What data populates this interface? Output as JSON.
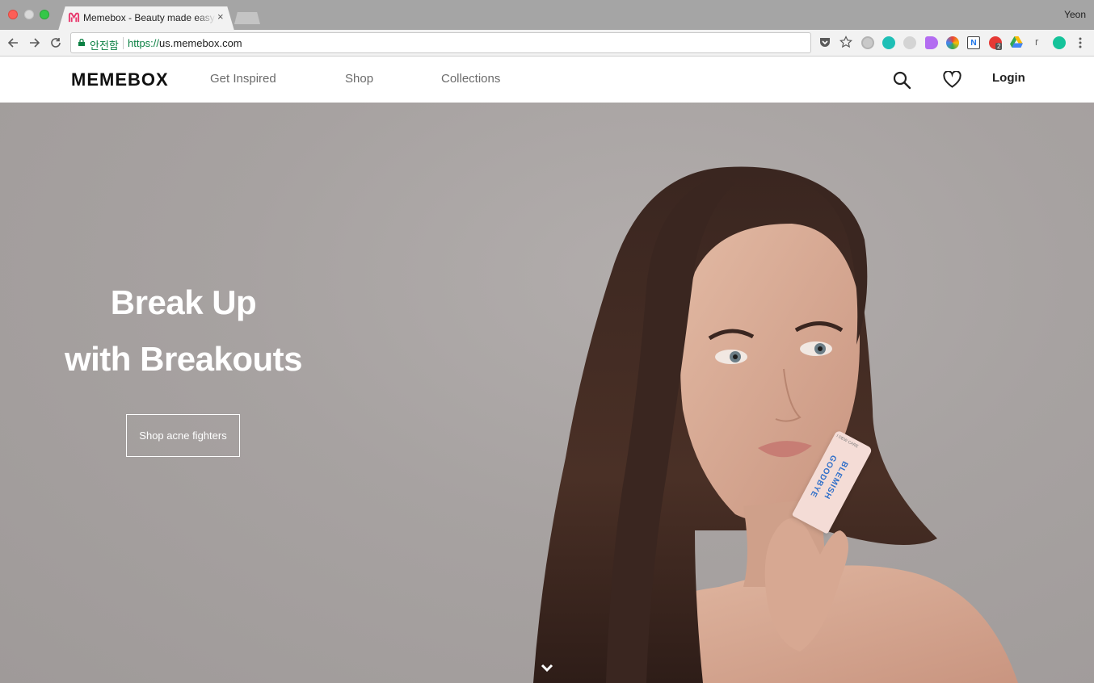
{
  "browser": {
    "tab_title": "Memebox - Beauty made easy",
    "tab_close": "×",
    "profile_name": "Yeon",
    "security_label": "안전함",
    "url_scheme": "https://",
    "url_host": "us.memebox.com",
    "extension_r": "r",
    "extension_badge": "2"
  },
  "header": {
    "logo": "MEMEBOX",
    "nav": [
      "Get Inspired",
      "Shop",
      "Collections"
    ],
    "login": "Login"
  },
  "hero": {
    "title_line1": "Break Up",
    "title_line2": "with Breakouts",
    "cta": "Shop acne fighters",
    "product_name_line1": "GOODBYE",
    "product_name_line2": "BLEMISH",
    "product_brand": "I DEW CARE"
  },
  "colors": {
    "brand_pink": "#e8386d",
    "hero_bg": "#a7a2a1",
    "secure_green": "#0b8043"
  }
}
